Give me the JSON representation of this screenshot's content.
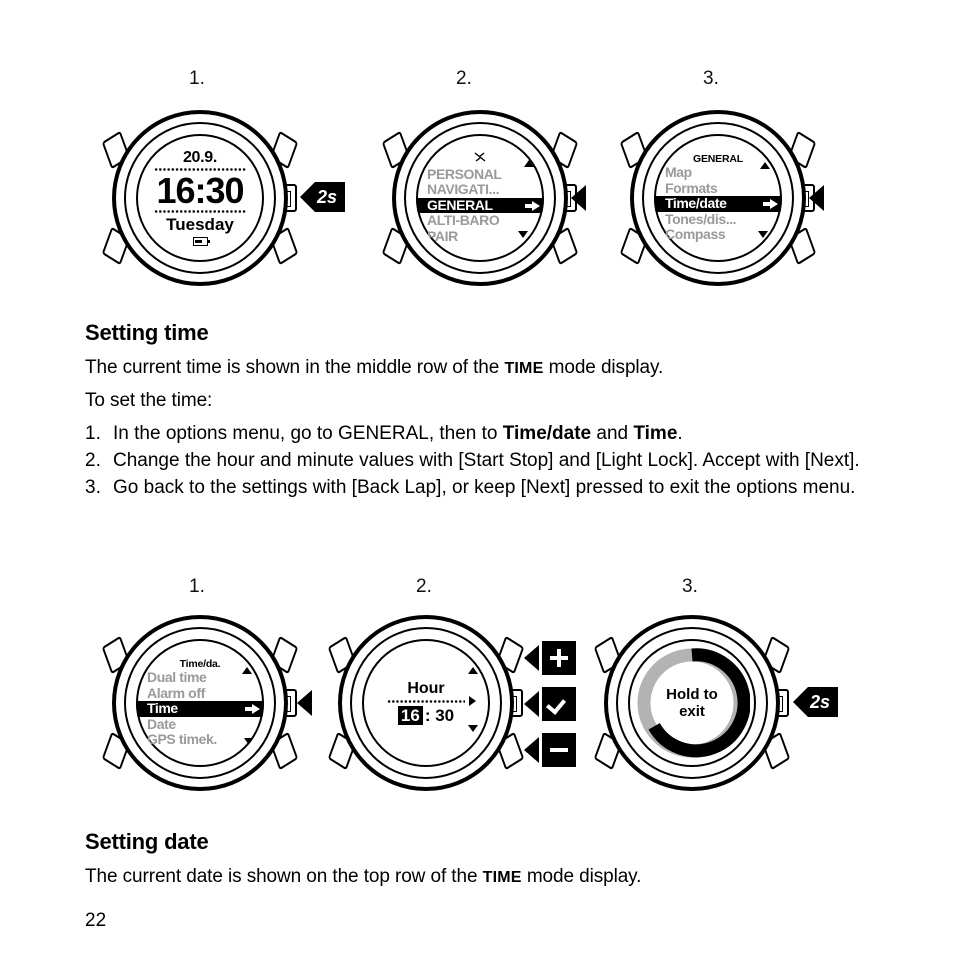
{
  "page": {
    "number": "22"
  },
  "figure_top": {
    "steps": [
      {
        "label": "1."
      },
      {
        "label": "2."
      },
      {
        "label": "3."
      }
    ],
    "watch1": {
      "type": "time-face",
      "date": "20.9.",
      "time": "16:30",
      "weekday": "Tuesday",
      "battery_icon": "battery-icon",
      "callout": "2s"
    },
    "watch2": {
      "type": "menu",
      "header_icon": "wrench-icon",
      "items": [
        {
          "label": "PERSONAL",
          "selected": false
        },
        {
          "label": "NAVIGATI...",
          "selected": false
        },
        {
          "label": "GENERAL",
          "selected": true
        },
        {
          "label": "ALTI-BARO",
          "selected": false
        },
        {
          "label": "PAIR",
          "selected": false
        }
      ],
      "callout_icon": "left-triangle-icon"
    },
    "watch3": {
      "type": "menu",
      "header": "GENERAL",
      "items": [
        {
          "label": "Map",
          "selected": false
        },
        {
          "label": "Formats",
          "selected": false
        },
        {
          "label": "Time/date",
          "selected": true
        },
        {
          "label": "Tones/dis...",
          "selected": false
        },
        {
          "label": "Compass",
          "selected": false
        }
      ],
      "callout_icon": "left-triangle-icon"
    }
  },
  "section_time": {
    "heading": "Setting time",
    "intro_a": "The current time is shown in the middle row of the ",
    "intro_a_sc": "TIME",
    "intro_a_end": " mode display.",
    "intro_b": "To set the time:",
    "steps": [
      {
        "num": "1.",
        "pre": "In the options menu, go to ",
        "sc": "GENERAL",
        "mid": ", then to ",
        "b1": "Time/date",
        "mid2": " and ",
        "b2": "Time",
        "end": "."
      },
      {
        "num": "2.",
        "text": "Change the hour and minute values with [Start Stop] and [Light Lock]. Accept with [Next]."
      },
      {
        "num": "3.",
        "text": "Go back to the settings with [Back Lap], or keep [Next] pressed to exit the options menu."
      }
    ]
  },
  "figure_bottom": {
    "steps": [
      {
        "label": "1."
      },
      {
        "label": "2."
      },
      {
        "label": "3."
      }
    ],
    "watch1": {
      "type": "menu",
      "header": "Time/da.",
      "items": [
        {
          "label": "Dual time",
          "selected": false
        },
        {
          "label": "Alarm off",
          "selected": false
        },
        {
          "label": "Time",
          "selected": true
        },
        {
          "label": "Date",
          "selected": false
        },
        {
          "label": "GPS timek.",
          "selected": false
        }
      ],
      "callout_icon": "left-triangle-icon"
    },
    "watch2": {
      "type": "value-edit",
      "field_label": "Hour",
      "value_selected": "16",
      "value_rest": ": 30",
      "side_arrows": [
        "up-triangle-icon",
        "right-triangle-icon",
        "down-triangle-icon"
      ],
      "buttons": [
        {
          "glyph": "plus-icon",
          "label": "+"
        },
        {
          "glyph": "check-icon",
          "label": "✔"
        },
        {
          "glyph": "minus-icon",
          "label": "−"
        }
      ]
    },
    "watch3": {
      "type": "hold-progress",
      "text_line1": "Hold to",
      "text_line2": "exit",
      "progress_percent": 75,
      "ring_color": "#000000",
      "ring_track_color": "#b3b3b3",
      "callout": "2s"
    }
  },
  "section_date": {
    "heading": "Setting date",
    "intro_a": "The current date is shown on the top row of the ",
    "intro_a_sc": "TIME",
    "intro_a_end": " mode display."
  }
}
